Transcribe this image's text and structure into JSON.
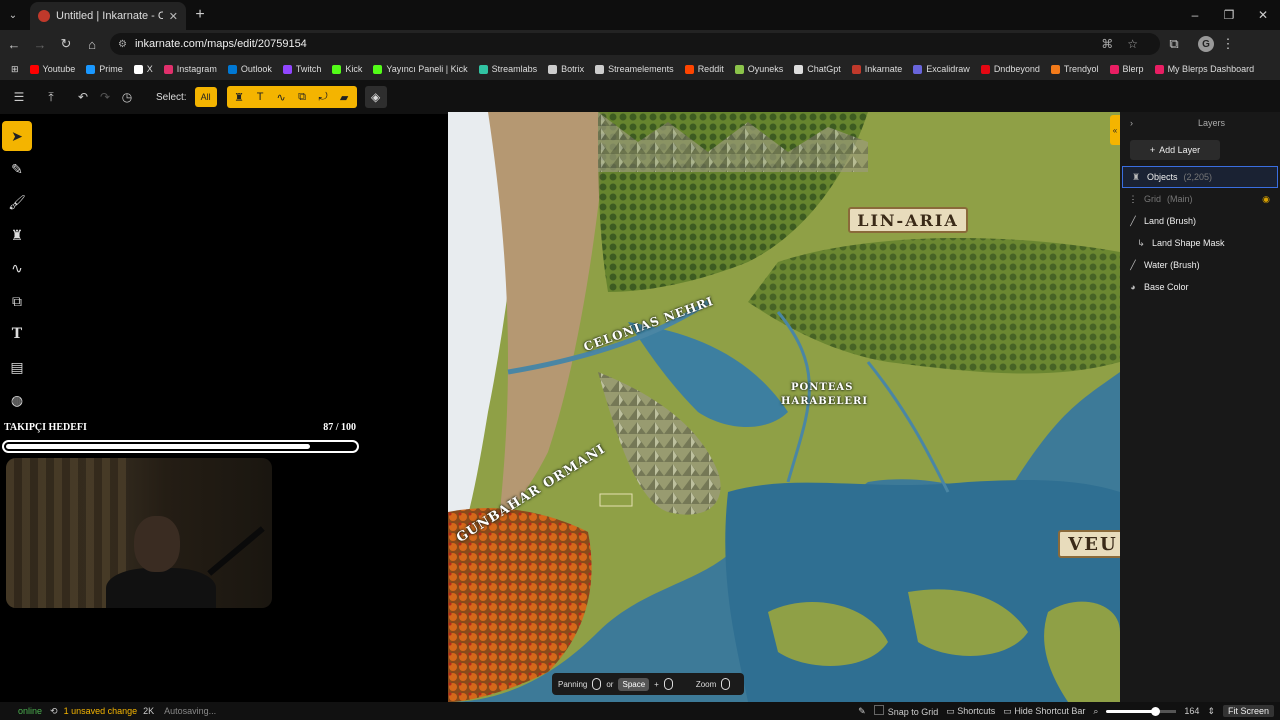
{
  "browser": {
    "tab_title": "Untitled | Inkarnate - Create Fa",
    "url": "inkarnate.com/maps/edit/20759154",
    "bookmarks": [
      {
        "label": "Youtube",
        "color": "#ff0000"
      },
      {
        "label": "Prime",
        "color": "#1a98ff"
      },
      {
        "label": "X",
        "color": "#ffffff"
      },
      {
        "label": "Instagram",
        "color": "#e1306c"
      },
      {
        "label": "Outlook",
        "color": "#0078d4"
      },
      {
        "label": "Twitch",
        "color": "#9146ff"
      },
      {
        "label": "Kick",
        "color": "#53fc18"
      },
      {
        "label": "Yayıncı Paneli | Kick",
        "color": "#53fc18"
      },
      {
        "label": "Streamlabs",
        "color": "#31c3a2"
      },
      {
        "label": "Botrix",
        "color": "#cccccc"
      },
      {
        "label": "Streamelements",
        "color": "#cccccc"
      },
      {
        "label": "Reddit",
        "color": "#ff4500"
      },
      {
        "label": "Oyuneks",
        "color": "#8bc34a"
      },
      {
        "label": "ChatGpt",
        "color": "#dddddd"
      },
      {
        "label": "Inkarnate",
        "color": "#c0392b"
      },
      {
        "label": "Excalidraw",
        "color": "#6965db"
      },
      {
        "label": "Dndbeyond",
        "color": "#e40712"
      },
      {
        "label": "Trendyol",
        "color": "#f27a1a"
      },
      {
        "label": "Blerp",
        "color": "#e91e63"
      },
      {
        "label": "My Blerps Dashboard",
        "color": "#e91e63"
      }
    ],
    "profile_initial": "G"
  },
  "toolbar": {
    "select_label": "Select:",
    "all_label": "All"
  },
  "goal": {
    "title": "TAKIPÇI HEDEFI",
    "count": "87 / 100",
    "progress": 0.87
  },
  "map": {
    "labels": {
      "linaria": "LIN-ARIA",
      "celonias": "CELONIAS NEHRI",
      "ponteas_1": "PONTEAS",
      "ponteas_2": "HARABELERI",
      "gunbahar": "GUNBAHAR ORMANI",
      "veu": "VEU"
    }
  },
  "shortcuts": {
    "panning": "Panning",
    "or": "or",
    "space": "Space",
    "plus": "+",
    "zoom": "Zoom"
  },
  "layers": {
    "title": "Layers",
    "add_label": "Add Layer",
    "items": [
      {
        "name": "Objects",
        "count": "(2,205)"
      },
      {
        "name": "Grid",
        "count": "(Main)"
      },
      {
        "name": "Land (Brush)"
      },
      {
        "name": "Land Shape Mask"
      },
      {
        "name": "Water (Brush)"
      },
      {
        "name": "Base Color"
      }
    ]
  },
  "status": {
    "online": "online",
    "unsaved": "1 unsaved change",
    "resolution": "2K",
    "autosave": "Autosaving...",
    "snap": "Snap to Grid",
    "shortcuts": "Shortcuts",
    "hide_bar": "Hide Shortcut Bar",
    "zoom_value": "164",
    "zoom_fraction": 0.7,
    "fit": "Fit Screen"
  }
}
